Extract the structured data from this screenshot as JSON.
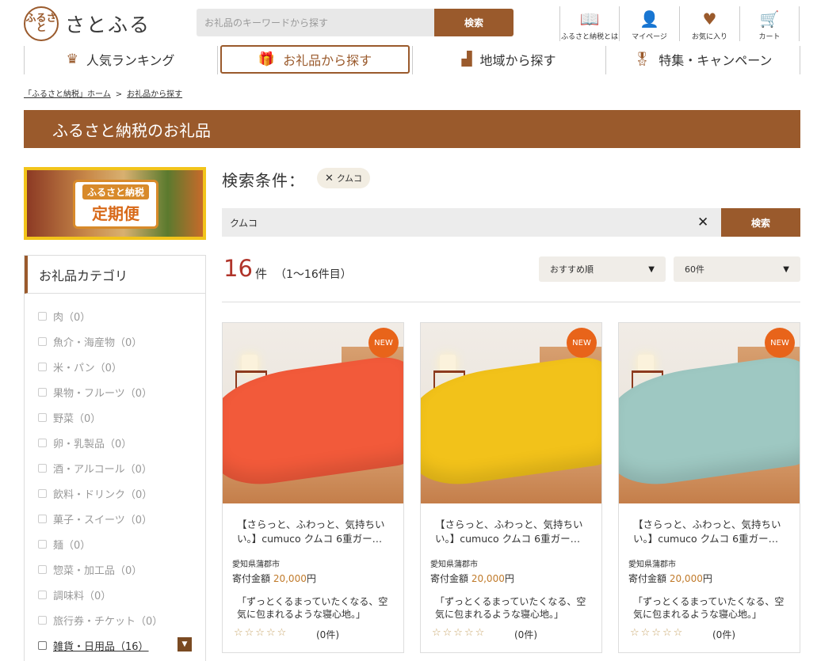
{
  "header": {
    "logo_mark": "ふるさと",
    "logo_text": "さとふる",
    "search_placeholder": "お礼品のキーワードから探す",
    "search_button": "検索",
    "icons": [
      {
        "name": "about-icon",
        "glyph": "📖",
        "label": "ふるさと納税とは"
      },
      {
        "name": "mypage-icon",
        "glyph": "👤",
        "label": "マイページ"
      },
      {
        "name": "favorite-icon",
        "glyph": "♥",
        "label": "お気に入り"
      },
      {
        "name": "cart-icon",
        "glyph": "🛒",
        "label": "カート"
      }
    ]
  },
  "nav": [
    {
      "label": "人気ランキング",
      "icon": "♛"
    },
    {
      "label": "お礼品から探す",
      "icon": "🎁"
    },
    {
      "label": "地域から探す",
      "icon": "▟"
    },
    {
      "label": "特集・キャンペーン",
      "icon": "🎖"
    }
  ],
  "breadcrumb": {
    "home": "「ふるさと納税」ホーム",
    "separator": ">",
    "current": "お礼品から探す"
  },
  "page_title": "ふるさと納税のお礼品",
  "banner": {
    "line1": "ふるさと納税",
    "line2": "定期便"
  },
  "category": {
    "heading": "お礼品カテゴリ",
    "items": [
      "肉（0）",
      "魚介・海産物（0）",
      "米・パン（0）",
      "果物・フルーツ（0）",
      "野菜（0）",
      "卵・乳製品（0）",
      "酒・アルコール（0）",
      "飲料・ドリンク（0）",
      "菓子・スイーツ（0）",
      "麺（0）",
      "惣菜・加工品（0）",
      "調味料（0）",
      "旅行券・チケット（0）",
      "雑貨・日用品（16）"
    ],
    "expand_icon": "▼"
  },
  "search": {
    "condition_label": "検索条件：",
    "tag": "クムコ",
    "tag_remove": "✕",
    "query": "クムコ",
    "clear": "✕",
    "button": "検索"
  },
  "results": {
    "count": "16",
    "unit": "件",
    "range": "（1〜16件目）",
    "sort": "おすすめ順",
    "per_page": "60件",
    "arrow": "▼"
  },
  "products": [
    {
      "badge": "NEW",
      "title": "【さらっと、ふわっと、気持ちいい。】cumuco クムコ 6重ガー…",
      "region": "愛知県蒲郡市",
      "price_label": "寄付金額",
      "price": "20,000",
      "price_unit": "円",
      "desc": "「ずっとくるまっていたくなる、空気に包まれるような寝心地。」",
      "stars": "☆☆☆☆☆",
      "reviews": "(0件)",
      "color": "#f25a3a"
    },
    {
      "badge": "NEW",
      "title": "【さらっと、ふわっと、気持ちいい。】cumuco クムコ 6重ガー…",
      "region": "愛知県蒲郡市",
      "price_label": "寄付金額",
      "price": "20,000",
      "price_unit": "円",
      "desc": "「ずっとくるまっていたくなる、空気に包まれるような寝心地。」",
      "stars": "☆☆☆☆☆",
      "reviews": "(0件)",
      "color": "#f2c21a"
    },
    {
      "badge": "NEW",
      "title": "【さらっと、ふわっと、気持ちいい。】cumuco クムコ 6重ガー…",
      "region": "愛知県蒲郡市",
      "price_label": "寄付金額",
      "price": "20,000",
      "price_unit": "円",
      "desc": "「ずっとくるまっていたくなる、空気に包まれるような寝心地。」",
      "stars": "☆☆☆☆☆",
      "reviews": "(0件)",
      "color": "#9ec8c2"
    }
  ],
  "colors": {
    "brand": "#9a5a2c",
    "count": "#b0342a",
    "new_badge": "#e8641a"
  }
}
